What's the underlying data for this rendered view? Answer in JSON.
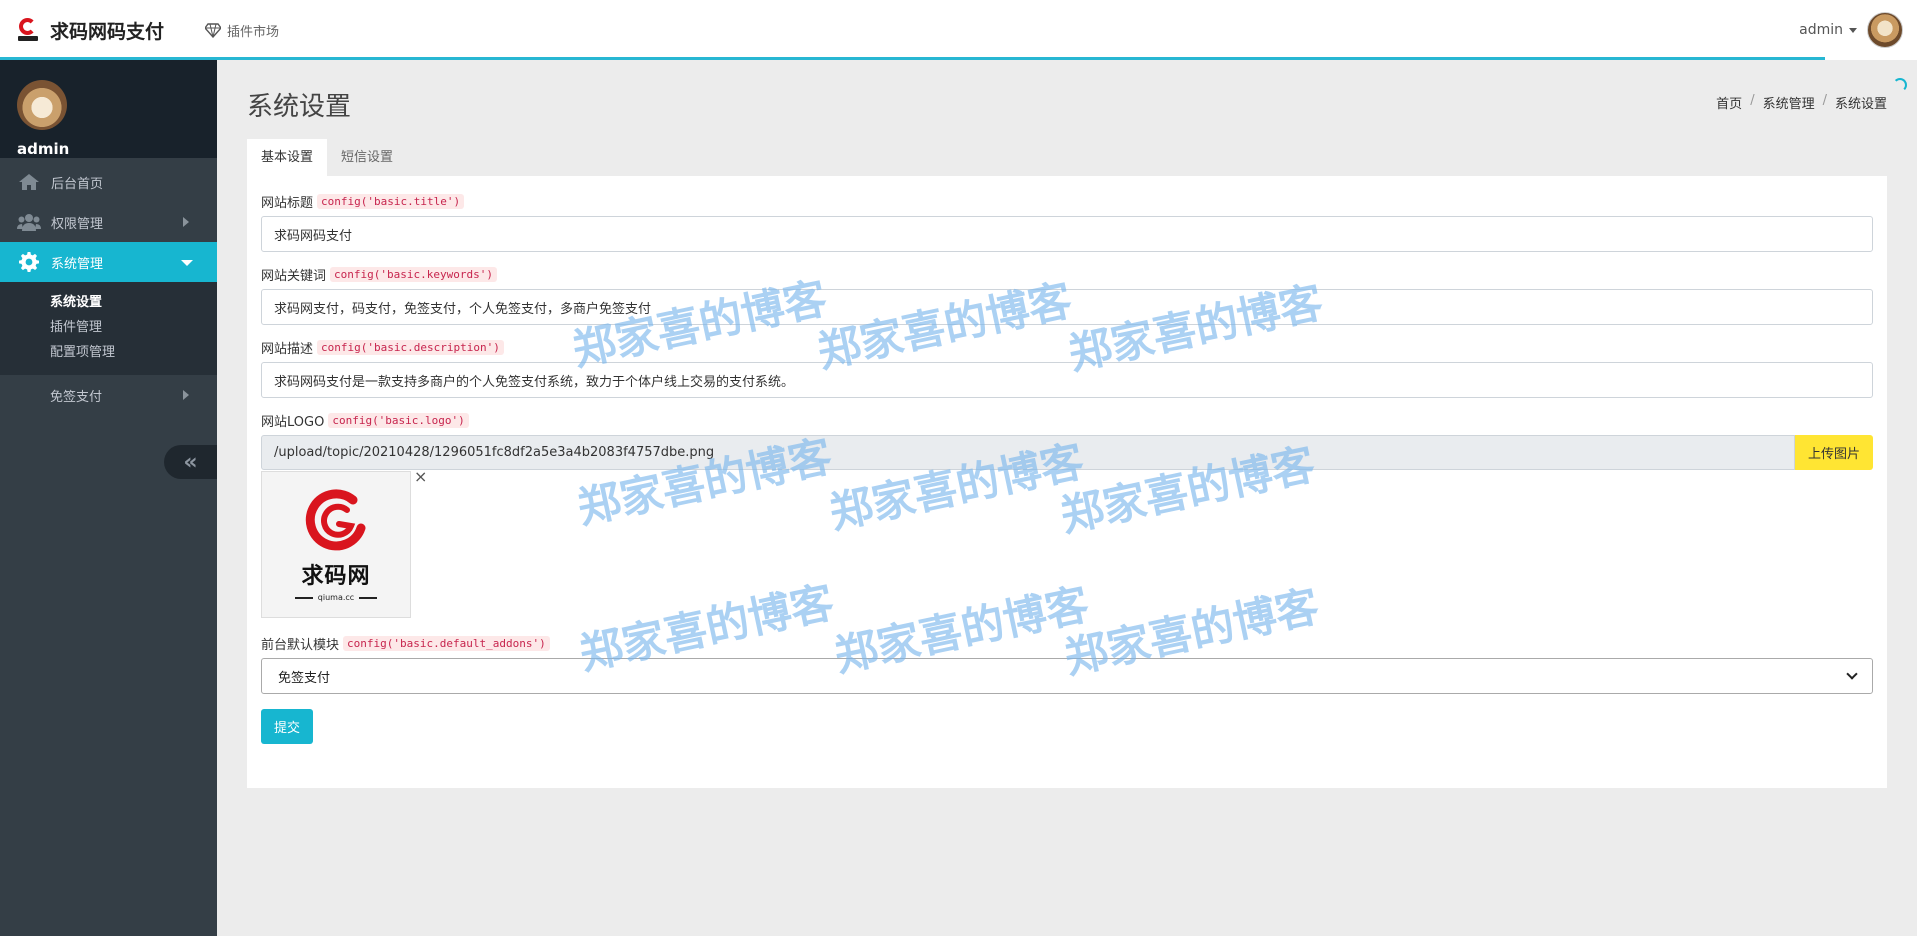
{
  "header": {
    "brand_name": "求码网码支付",
    "plugin_market": "插件市场",
    "user_name": "admin",
    "accent_color": "#27b7d3"
  },
  "sidebar": {
    "user_name": "admin",
    "items": [
      {
        "label": "后台首页",
        "icon": "home-icon"
      },
      {
        "label": "权限管理",
        "icon": "users-icon"
      },
      {
        "label": "系统管理",
        "icon": "gear-icon"
      },
      {
        "label": "免签支付",
        "icon": ""
      }
    ],
    "submenu": [
      {
        "label": "系统设置"
      },
      {
        "label": "插件管理"
      },
      {
        "label": "配置项管理"
      }
    ],
    "collapse_label": "«"
  },
  "page": {
    "title": "系统设置",
    "breadcrumb": [
      "首页",
      "系统管理",
      "系统设置"
    ],
    "tabs": [
      {
        "label": "基本设置"
      },
      {
        "label": "短信设置"
      }
    ]
  },
  "form": {
    "title": {
      "label": "网站标题",
      "code": "config('basic.title')",
      "value": "求码网码支付"
    },
    "keywords": {
      "label": "网站关键词",
      "code": "config('basic.keywords')",
      "value": "求码网支付，码支付，免签支付，个人免签支付，多商户免签支付"
    },
    "description": {
      "label": "网站描述",
      "code": "config('basic.description')",
      "value": "求码网码支付是一款支持多商户的个人免签支付系统，致力于个体户线上交易的支付系统。"
    },
    "logo": {
      "label": "网站LOGO",
      "code": "config('basic.logo')",
      "value": "/upload/topic/20210428/1296051fc8df2a5e3a4b2083f4757dbe.png",
      "upload_label": "上传图片",
      "preview_brand": "求码网",
      "preview_url": "qiuma.cc",
      "remove": "×"
    },
    "default_addons": {
      "label": "前台默认模块",
      "code": "config('basic.default_addons')",
      "value": "免签支付"
    },
    "submit_label": "提交"
  },
  "watermark": {
    "text": "郑家喜的博客"
  }
}
